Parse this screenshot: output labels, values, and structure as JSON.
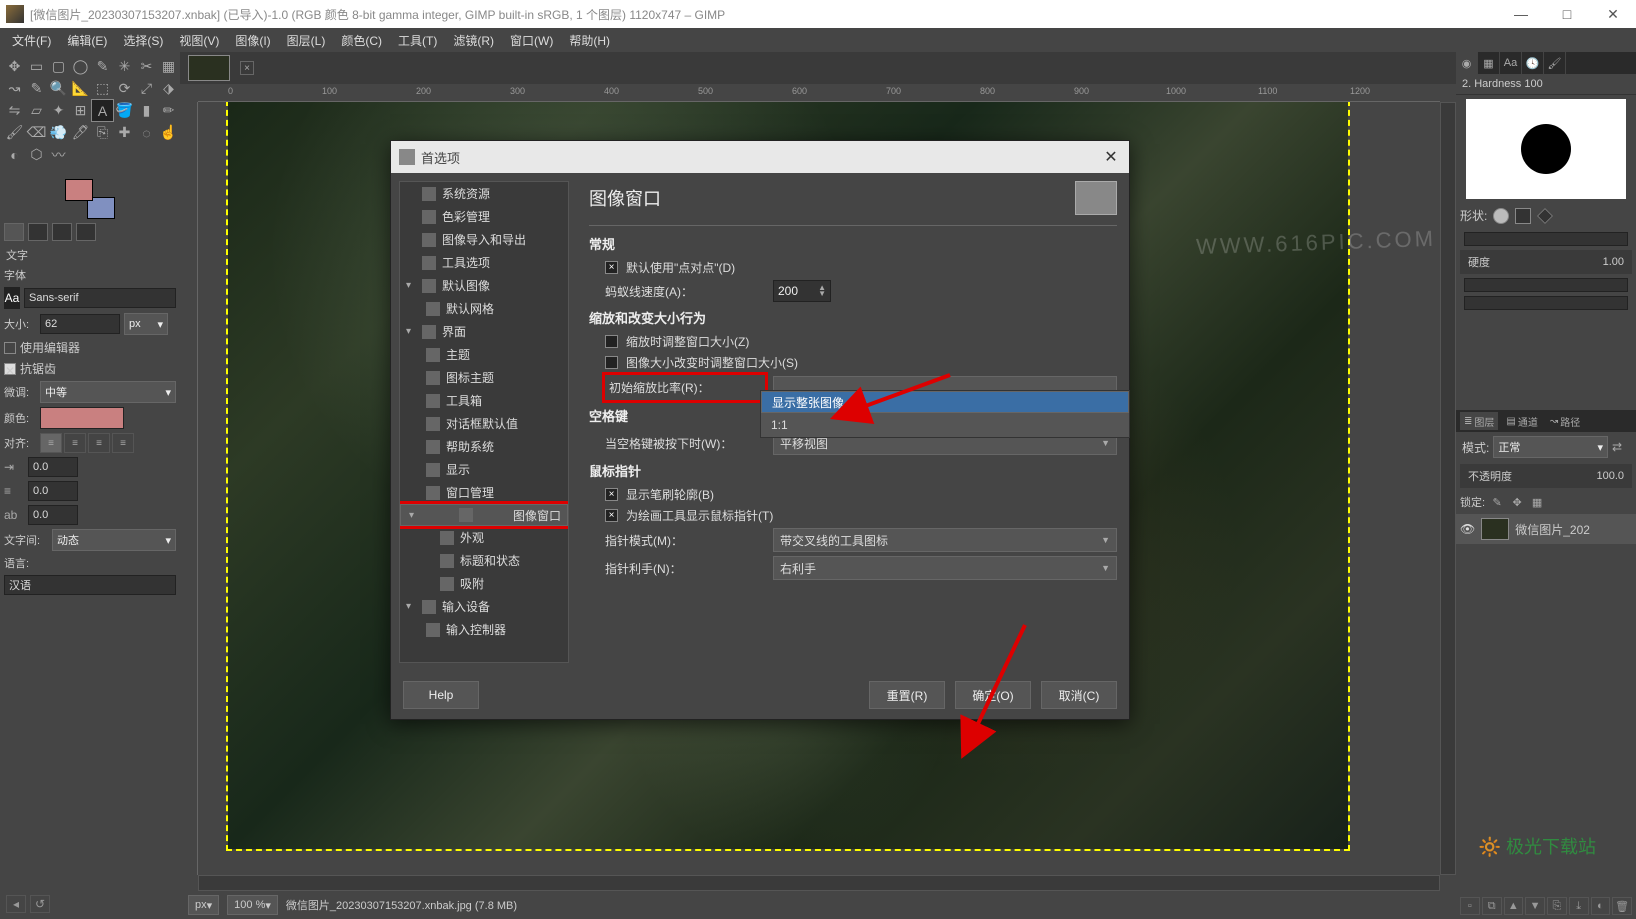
{
  "titlebar": {
    "text": "[微信图片_20230307153207.xnbak] (已导入)-1.0 (RGB 颜色 8-bit gamma integer, GIMP built-in sRGB, 1 个图层) 1120x747 – GIMP"
  },
  "menus": [
    "文件(F)",
    "编辑(E)",
    "选择(S)",
    "视图(V)",
    "图像(I)",
    "图层(L)",
    "颜色(C)",
    "工具(T)",
    "滤镜(R)",
    "窗口(W)",
    "帮助(H)"
  ],
  "toolopts": {
    "section": "文字",
    "font_label": "字体",
    "font_value": "Sans-serif",
    "size_label": "大小:",
    "size_value": "62",
    "size_unit": "px",
    "use_editor": "使用编辑器",
    "antialias": "抗锯齿",
    "hint_label": "微调:",
    "hint_value": "中等",
    "color_label": "颜色:",
    "align_label": "对齐:",
    "indent1": "0.0",
    "indent2": "0.0",
    "indent3": "0.0",
    "charspace_label": "文字间:",
    "charspace_value": "动态",
    "lang_label": "语言:",
    "lang_value": "汉语"
  },
  "statusbar": {
    "unit": "px",
    "zoom": "100 %",
    "file": "微信图片_20230307153207.xnbak.jpg (7.8 MB)"
  },
  "right": {
    "brush_title": "2. Hardness 100",
    "shape_label": "形状:",
    "hardness_label": "硬度",
    "hardness_value": "1.00",
    "layers_tab": "图层",
    "channels_tab": "通道",
    "paths_tab": "路径",
    "mode_label": "模式:",
    "mode_value": "正常",
    "opacity_label": "不透明度",
    "opacity_value": "100.0",
    "lock_label": "锁定:",
    "layer_name": "微信图片_202"
  },
  "dialog": {
    "title": "首选项",
    "tree": {
      "sys": "系统资源",
      "color": "色彩管理",
      "impexp": "图像导入和导出",
      "toolopt": "工具选项",
      "defimg": "默认图像",
      "defgrid": "默认网格",
      "iface": "界面",
      "theme": "主题",
      "icontheme": "图标主题",
      "toolbox": "工具箱",
      "dlgdef": "对话框默认值",
      "help": "帮助系统",
      "display": "显示",
      "winmgmt": "窗口管理",
      "imgwin": "图像窗口",
      "appear": "外观",
      "titlestatus": "标题和状态",
      "snap": "吸附",
      "indev": "输入设备",
      "inctl": "输入控制器"
    },
    "pane": {
      "heading": "图像窗口",
      "sec_general": "常规",
      "dot_for_dot": "默认使用\"点对点\"(D)",
      "ant_label": "蚂蚁线速度(A)：",
      "ant_value": "200",
      "sec_zoom": "缩放和改变大小行为",
      "resize_on_zoom": "缩放时调整窗口大小(Z)",
      "resize_on_size": "图像大小改变时调整窗口大小(S)",
      "init_zoom_label": "初始缩放比率(R)：",
      "popup_fit": "显示整张图像",
      "popup_11": "1:1",
      "sec_space": "空格键",
      "space_label": "当空格键被按下时(W)：",
      "space_value": "平移视图",
      "sec_pointer": "鼠标指针",
      "show_brush": "显示笔刷轮廓(B)",
      "show_tool": "为绘画工具显示鼠标指针(T)",
      "ptr_mode_label": "指针模式(M)：",
      "ptr_mode_value": "带交叉线的工具图标",
      "ptr_hand_label": "指针利手(N)：",
      "ptr_hand_value": "右利手"
    },
    "buttons": {
      "help": "Help",
      "reset": "重置(R)",
      "ok": "确定(O)",
      "cancel": "取消(C)"
    }
  },
  "ruler_marks": [
    "0",
    "100",
    "200",
    "300",
    "400",
    "500",
    "600",
    "700",
    "800",
    "900",
    "1000",
    "1100",
    "1200"
  ],
  "watermark": "WWW.616PIC.COM",
  "logo": "极光下载站"
}
